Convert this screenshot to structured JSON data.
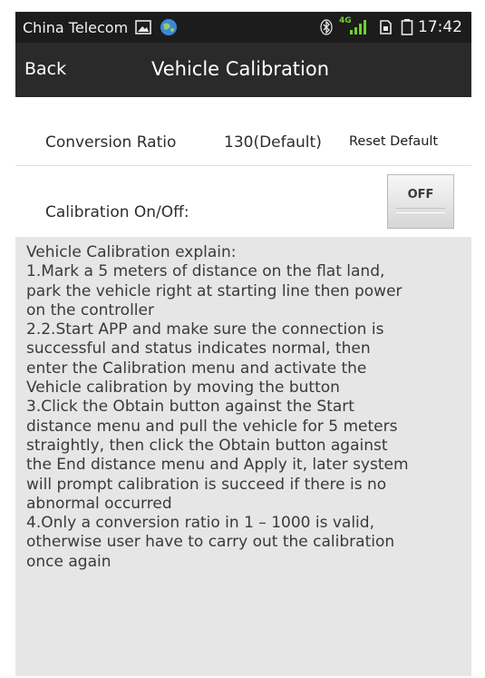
{
  "status_bar": {
    "carrier": "China Telecom",
    "network": "4G",
    "time": "17:42"
  },
  "header": {
    "back_label": "Back",
    "title": "Vehicle Calibration"
  },
  "settings": {
    "conversion_label": "Conversion Ratio",
    "conversion_value": "130(Default)",
    "reset_label": "Reset Default",
    "calibration_label": "Calibration On/Off:",
    "toggle_label": "OFF"
  },
  "explain": {
    "lines": [
      "Vehicle Calibration explain:",
      "1.Mark a 5 meters of distance on the flat land,",
      "park the vehicle right at starting line then power",
      "on the controller",
      "2.2.Start APP and make sure the connection is",
      "successful and status indicates normal, then",
      "enter the Calibration menu and activate the",
      "Vehicle calibration by moving the button",
      "3.Click the Obtain button against the Start",
      "distance menu and pull the vehicle for 5 meters",
      "straightly, then click the Obtain button against",
      "the End distance menu and Apply it, later system",
      "will prompt calibration is succeed if there is no",
      "abnormal occurred",
      "4.Only a conversion ratio in 1 – 1000 is valid,",
      "otherwise user have to carry out the calibration",
      "once again"
    ]
  },
  "icons": {
    "gallery": "gallery-icon",
    "browser": "globe-icon",
    "bluetooth": "bluetooth-icon",
    "signal": "signal-icon",
    "sim": "sim-card-icon",
    "battery": "battery-icon"
  },
  "colors": {
    "status_bar": "#1c1c1c",
    "title_bar": "#2a2a2a",
    "background": "#e6e6e6",
    "card": "#ffffff",
    "network_accent": "#6fcf2a"
  }
}
